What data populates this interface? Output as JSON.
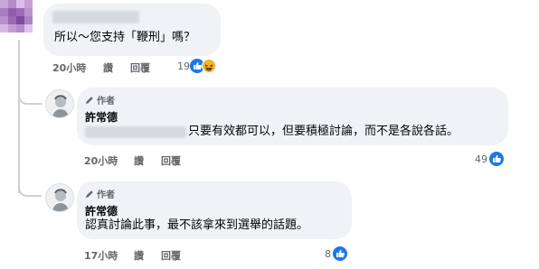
{
  "comment": {
    "text": "所以～您支持「鞭刑」嗎？",
    "time": "20小時",
    "like_label": "讚",
    "reply_label": "回覆",
    "reaction_count": "19",
    "reaction_icons": [
      "like-icon",
      "haha-icon"
    ]
  },
  "replies": [
    {
      "author_badge": "作者",
      "name": "許常德",
      "text": "只要有效都可以，但要積極討論，而不是各說各話。",
      "time": "20小時",
      "like_label": "讚",
      "reply_label": "回覆",
      "reaction_count": "49",
      "reaction_icon": "like-icon"
    },
    {
      "author_badge": "作者",
      "name": "許常德",
      "text": "認真討論此事，最不該拿來到選舉的話題。",
      "time": "17小時",
      "like_label": "讚",
      "reply_label": "回覆",
      "reaction_count": "8",
      "reaction_icon": "like-icon"
    }
  ],
  "colors": {
    "bubble": "#f0f2f5",
    "like_blue": "#1877f2",
    "meta_gray": "#65676b",
    "thread_line": "#ced0d4"
  }
}
